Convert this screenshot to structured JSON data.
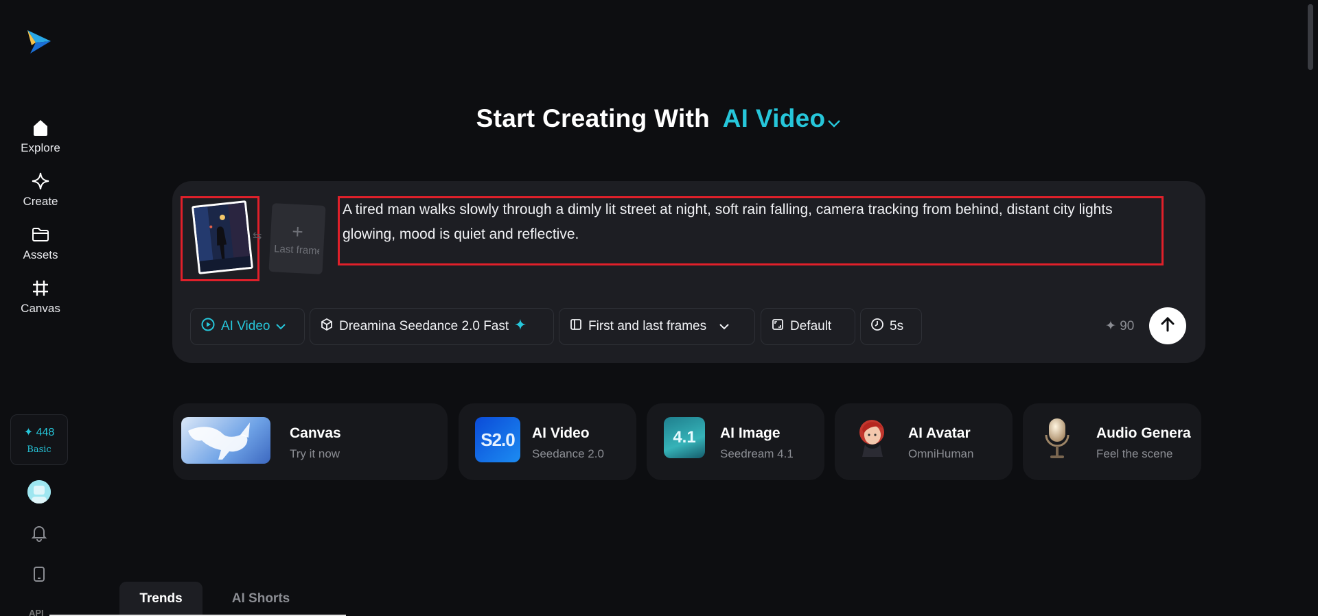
{
  "sidebar": {
    "items": [
      {
        "label": "Explore"
      },
      {
        "label": "Create"
      },
      {
        "label": "Assets"
      },
      {
        "label": "Canvas"
      }
    ],
    "credits": {
      "value": "✦ 448",
      "plan": "Basic"
    },
    "api_label": "API"
  },
  "header": {
    "title_prefix": "Start Creating With",
    "title_accent": "AI Video"
  },
  "prompt": {
    "last_frame_label": "Last frame",
    "text": "A tired man walks slowly through a dimly lit street at night, soft rain falling, camera tracking from behind, distant city lights glowing, mood is quiet and reflective.",
    "toolbar": {
      "mode": "AI Video",
      "model": "Dreamina Seedance 2.0 Fast",
      "frames": "First and last frames",
      "ratio": "Default",
      "duration": "5s",
      "cost": "✦ 90"
    }
  },
  "features": [
    {
      "title": "Canvas",
      "subtitle": "Try it now"
    },
    {
      "title": "AI Video",
      "subtitle": "Seedance 2.0",
      "badge": "S2.0"
    },
    {
      "title": "AI Image",
      "subtitle": "Seedream 4.1",
      "badge": "4.1"
    },
    {
      "title": "AI Avatar",
      "subtitle": "OmniHuman"
    },
    {
      "title": "Audio Genera",
      "subtitle": "Feel the scene"
    }
  ],
  "tabs": [
    {
      "label": "Trends"
    },
    {
      "label": "AI Shorts"
    }
  ],
  "colors": {
    "accent": "#26c6da",
    "background": "#0d0e11",
    "card": "#1d1e23",
    "highlight": "#e0202a"
  }
}
